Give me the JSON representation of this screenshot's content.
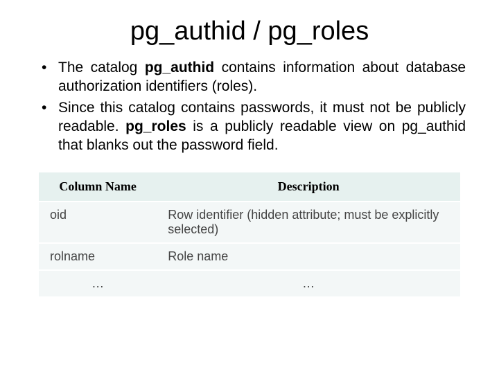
{
  "title": "pg_authid / pg_roles",
  "bullets": {
    "b1a": "The catalog ",
    "b1b": "pg_authid",
    "b1c": " contains information about database authorization identifiers (roles).",
    "b2a": "Since this catalog contains passwords, it must not be publicly readable. ",
    "b2b": "pg_roles",
    "b2c": " is a publicly readable view on pg_authid that blanks out the password field."
  },
  "table": {
    "headers": {
      "col1": "Column Name",
      "col2": "Description"
    },
    "rows": [
      {
        "name": "oid",
        "desc": "Row identifier (hidden attribute; must be explicitly selected)"
      },
      {
        "name": "rolname",
        "desc": "Role name"
      },
      {
        "name": "…",
        "desc": "…"
      }
    ]
  }
}
